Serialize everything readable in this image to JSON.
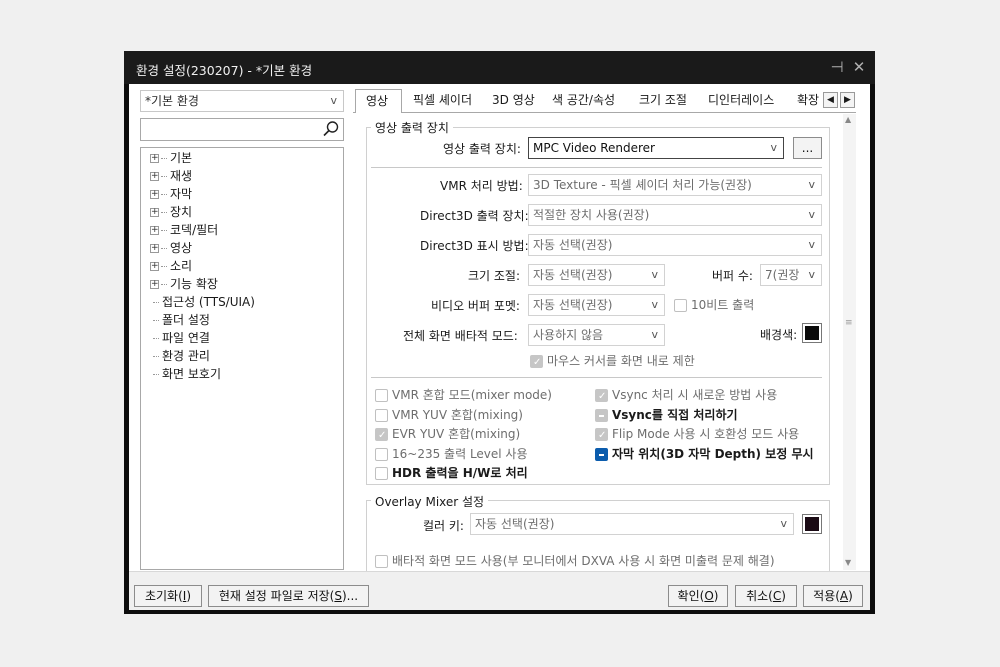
{
  "window": {
    "title": "환경 설정(230207) - *기본 환경",
    "pin_icon": "pin-icon",
    "close_icon": "close-icon"
  },
  "left": {
    "profile_value": "*기본 환경",
    "search_placeholder": "",
    "tree": [
      {
        "label": "기본",
        "expandable": true
      },
      {
        "label": "재생",
        "expandable": true
      },
      {
        "label": "자막",
        "expandable": true
      },
      {
        "label": "장치",
        "expandable": true
      },
      {
        "label": "코덱/필터",
        "expandable": true
      },
      {
        "label": "영상",
        "expandable": true
      },
      {
        "label": "소리",
        "expandable": true
      },
      {
        "label": "기능 확장",
        "expandable": true
      },
      {
        "label": "접근성 (TTS/UIA)",
        "expandable": false
      },
      {
        "label": "폴더 설정",
        "expandable": false
      },
      {
        "label": "파일 연결",
        "expandable": false
      },
      {
        "label": "환경 관리",
        "expandable": false
      },
      {
        "label": "화면 보호기",
        "expandable": false
      }
    ]
  },
  "tabs": [
    "영상",
    "픽셀 셰이더",
    "3D 영상",
    "색 공간/속성",
    "크기 조절",
    "디인터레이스",
    "확장"
  ],
  "output_group": {
    "title": "영상 출력 장치",
    "device_label": "영상 출력 장치:",
    "device_value": "MPC Video Renderer",
    "more_button": "...",
    "vmr_label": "VMR 처리 방법:",
    "vmr_value": "3D Texture - 픽셀 셰이더 처리 가능(권장)",
    "d3d_out_label": "Direct3D 출력 장치:",
    "d3d_out_value": "적절한 장치 사용(권장)",
    "d3d_disp_label": "Direct3D 표시 방법:",
    "d3d_disp_value": "자동 선택(권장)",
    "resize_label": "크기 조절:",
    "resize_value": "자동 선택(권장)",
    "buffer_label": "버퍼 수:",
    "buffer_value": "7(권장",
    "vbuffer_label": "비디오 버퍼 포멧:",
    "vbuffer_value": "자동 선택(권장)",
    "tenbit_label": "10비트 출력",
    "fullscreen_label": "전체 화면 배타적 모드:",
    "fullscreen_value": "사용하지 않음",
    "bgcolor_label": "배경색:",
    "bgcolor": "#0a0a0a",
    "mouse_limit_label": "마우스 커서를 화면 내로 제한"
  },
  "options_left": [
    {
      "label": "VMR 혼합 모드(mixer mode)",
      "state": "unchecked",
      "bold": false
    },
    {
      "label": "VMR YUV 혼합(mixing)",
      "state": "unchecked",
      "bold": false
    },
    {
      "label": "EVR YUV 혼합(mixing)",
      "state": "checked",
      "bold": false
    },
    {
      "label": "16~235 출력 Level 사용",
      "state": "unchecked",
      "bold": false
    },
    {
      "label": "HDR 출력을 H/W로 처리",
      "state": "unchecked-enabled",
      "bold": true
    }
  ],
  "options_right": [
    {
      "label": "Vsync 처리 시 새로운 방법 사용",
      "state": "checked",
      "bold": false
    },
    {
      "label": "Vsync를 직접 처리하기",
      "state": "indeterminate",
      "bold": true
    },
    {
      "label": "Flip Mode 사용 시 호환성 모드 사용",
      "state": "checked",
      "bold": false
    },
    {
      "label": "자막 위치(3D 자막 Depth) 보정 무시",
      "state": "indeterminate-active",
      "bold": true
    }
  ],
  "overlay_group": {
    "title": "Overlay Mixer 설정",
    "colorkey_label": "컬러 키:",
    "colorkey_value": "자동 선택(권장)",
    "colorkey_color": "#1a0a14",
    "exclusive_label": "배타적 화면 모드 사용(부 모니터에서 DXVA 사용 시 화면 미출력 문제 해결)"
  },
  "footer": {
    "reset_text": "초기화(",
    "reset_key": "I",
    "reset_tail": ")",
    "save_text": "현재 설정 파일로 저장(",
    "save_key": "S",
    "save_tail": ")...",
    "ok_text": "확인(",
    "ok_key": "O",
    "ok_tail": ")",
    "cancel_text": "취소(",
    "cancel_key": "C",
    "cancel_tail": ")",
    "apply_text": "적용(",
    "apply_key": "A",
    "apply_tail": ")"
  }
}
